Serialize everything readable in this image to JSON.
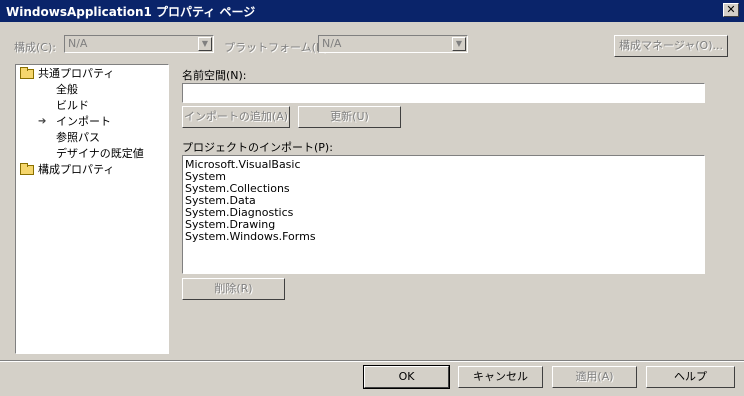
{
  "window": {
    "title": "WindowsApplication1 プロパティ ページ",
    "close_glyph": "✕"
  },
  "config": {
    "config_label": "構成(C):",
    "config_value": "N/A",
    "platform_label": "プラットフォーム(P):",
    "platform_value": "N/A",
    "manager_button": "構成マネージャ(O)..."
  },
  "tree": {
    "common_props": "共通プロパティ",
    "items": [
      "全般",
      "ビルド",
      "インポート",
      "参照パス",
      "デザイナの既定値"
    ],
    "selected_index": 2,
    "config_props": "構成プロパティ"
  },
  "imports": {
    "namespace_label": "名前空間(N):",
    "namespace_value": "",
    "add_button": "インポートの追加(A)",
    "update_button": "更新(U)",
    "project_imports_label": "プロジェクトのインポート(P):",
    "list": [
      "Microsoft.VisualBasic",
      "System",
      "System.Collections",
      "System.Data",
      "System.Diagnostics",
      "System.Drawing",
      "System.Windows.Forms"
    ],
    "remove_button": "削除(R)"
  },
  "footer": {
    "ok": "OK",
    "cancel": "キャンセル",
    "apply": "適用(A)",
    "help": "ヘルプ"
  },
  "colors": {
    "titlebar": "#0a246a",
    "face": "#d4d0c8",
    "folder": "#f5d66d"
  }
}
